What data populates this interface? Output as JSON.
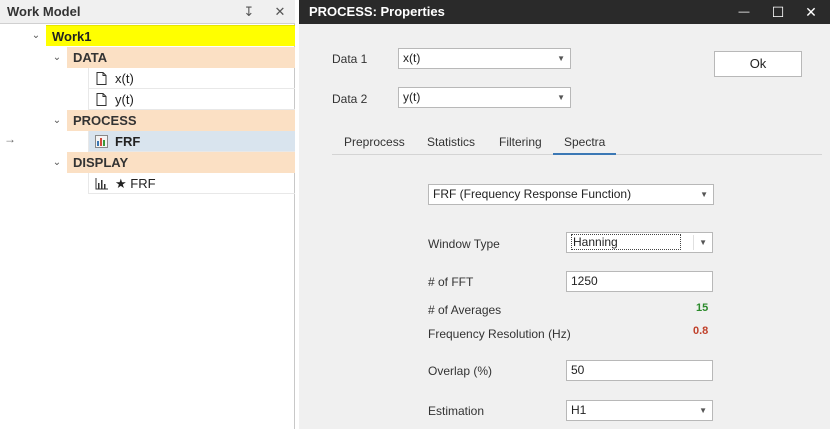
{
  "left_panel": {
    "title": "Work Model",
    "pin_glyph": "↧",
    "close_glyph": "✕",
    "tree": {
      "root_label": "Work1",
      "data_label": "DATA",
      "data_items": [
        "x(t)",
        "y(t)"
      ],
      "process_label": "PROCESS",
      "process_item": "FRF",
      "display_label": "DISPLAY",
      "display_item": "★ FRF",
      "current_row_marker": "→"
    }
  },
  "dialog": {
    "title": "PROCESS: Properties",
    "minimize_glyph": "—",
    "maximize_glyph": "☐",
    "close_glyph": "✕",
    "data1_label": "Data 1",
    "data1_value": "x(t)",
    "data2_label": "Data 2",
    "data2_value": "y(t)",
    "ok_label": "Ok",
    "tabs": [
      "Preprocess",
      "Statistics",
      "Filtering",
      "Spectra"
    ],
    "active_tab": "Spectra",
    "spectra": {
      "function_value": "FRF (Frequency Response Function)",
      "window_type_label": "Window Type",
      "window_type_value": "Hanning",
      "fft_label": "# of FFT",
      "fft_value": "1250",
      "averages_label": "# of Averages",
      "averages_value": "15",
      "resolution_label": "Frequency Resolution (Hz)",
      "resolution_value": "0.8",
      "overlap_label": "Overlap (%)",
      "overlap_value": "50",
      "estimation_label": "Estimation",
      "estimation_value": "H1"
    }
  },
  "icons": {
    "expander": "chevron-down-icon",
    "document": "document-icon",
    "process": "bar-chart-color-icon",
    "display": "bar-chart-icon",
    "dropdown": "caret-down-icon"
  },
  "colors": {
    "root_highlight": "#ffff00",
    "group_header": "#fbe0c4",
    "selected_row": "#d9e4ee",
    "titlebar": "#2a2a2a",
    "tab_accent": "#3b78b5",
    "averages_value": "#2b8a2b",
    "resolution_value": "#c0402a"
  }
}
